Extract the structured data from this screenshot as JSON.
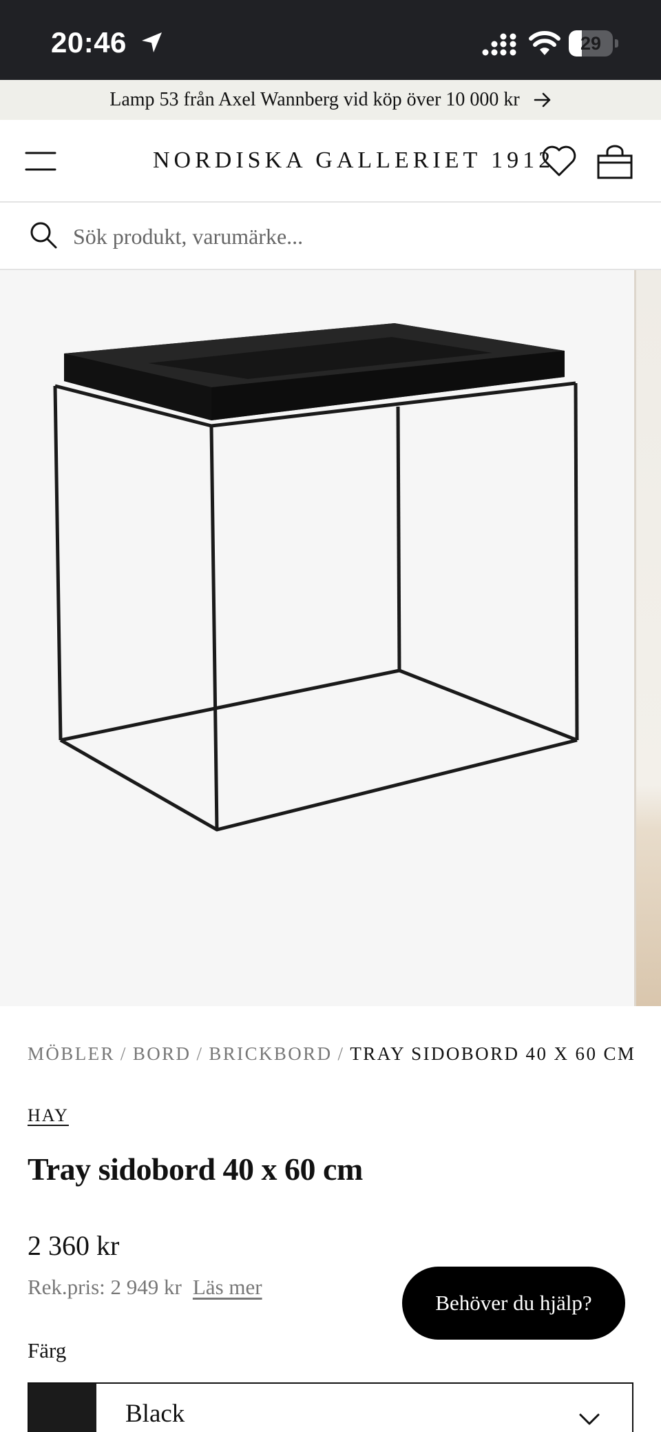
{
  "status_bar": {
    "time": "20:46",
    "battery_level": "29",
    "battery_fraction": 0.29,
    "icons": [
      "location-arrow-icon",
      "cellular-signal-icon",
      "wifi-icon",
      "battery-icon"
    ]
  },
  "promo": {
    "text": "Lamp 53 från Axel Wannberg vid köp över 10 000 kr",
    "icon": "arrow-right-icon"
  },
  "header": {
    "logo": "NORDISKA GALLERIET 1912",
    "icons": [
      "menu-icon",
      "heart-icon",
      "shopping-bag-icon"
    ]
  },
  "search": {
    "placeholder": "Sök produkt, varumärke...",
    "value": "",
    "icon": "search-icon"
  },
  "gallery": {
    "image": "Black tray side table product photo",
    "background": "#f6f6f6"
  },
  "breadcrumb": {
    "items": [
      "MÖBLER",
      "BORD",
      "BRICKBORD"
    ],
    "current": "TRAY SIDOBORD 40 X 60 CM",
    "separator": "/"
  },
  "product": {
    "brand": "HAY",
    "title": "Tray sidobord 40 x 60 cm",
    "price": "2 360 kr",
    "rrp": "Rek.pris: 2 949 kr",
    "read_more": "Läs mer"
  },
  "help": {
    "label": "Behöver du hjälp?"
  },
  "color_option": {
    "label": "Färg",
    "selected": "Black",
    "swatch": "#1b1b1b"
  },
  "colors": {
    "status_bar_bg": "#202125",
    "promo_bg": "#efefea",
    "text": "#111111",
    "muted": "#777777"
  }
}
